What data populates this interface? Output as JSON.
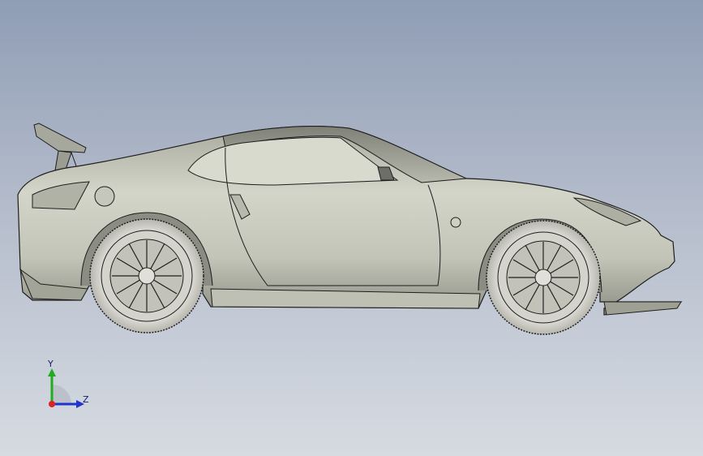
{
  "viewport": {
    "background_top": "#8f9db5",
    "background_bottom": "#d6dbe2"
  },
  "model": {
    "subject": "sports-car",
    "body_color": "#c9c9bd",
    "edge_color": "#1e1e1e",
    "tire_color": "#d8d8d2"
  },
  "triad": {
    "y_label": "Y",
    "z_label": "Z",
    "y_color": "#22aa22",
    "z_color": "#2233cc",
    "x_color": "#dd2222"
  }
}
